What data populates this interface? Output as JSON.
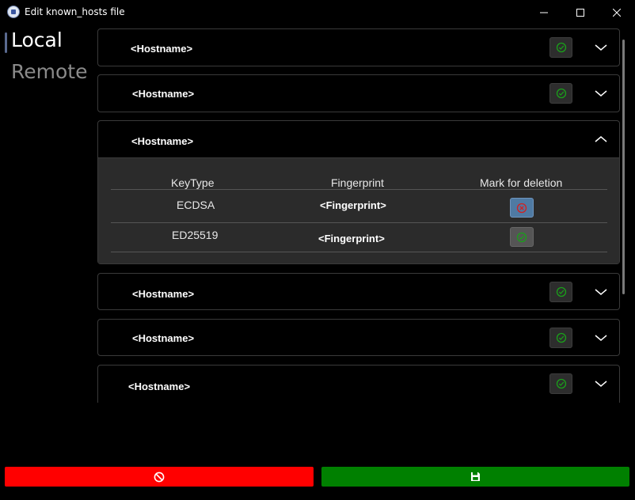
{
  "window": {
    "title": "Edit known_hosts file",
    "icons": {
      "app": "app-icon",
      "minimize": "minimize-icon",
      "maximize": "maximize-icon",
      "close": "close-icon"
    }
  },
  "nav": {
    "items": [
      {
        "label": "Local",
        "selected": true
      },
      {
        "label": "Remote",
        "selected": false
      }
    ]
  },
  "hosts": [
    {
      "hostname": "<Hostname>",
      "expanded": false,
      "status_icon": "check-circle-icon"
    },
    {
      "hostname": "<Hostname>",
      "expanded": false,
      "status_icon": "check-circle-icon"
    },
    {
      "hostname": "<Hostname>",
      "expanded": true
    },
    {
      "hostname": "<Hostname>",
      "expanded": false,
      "status_icon": "check-circle-icon"
    },
    {
      "hostname": "<Hostname>",
      "expanded": false,
      "status_icon": "check-circle-icon"
    },
    {
      "hostname": "<Hostname>",
      "expanded": false,
      "status_icon": "check-circle-icon"
    }
  ],
  "keys_table": {
    "headers": [
      "KeyType",
      "Fingerprint",
      "Mark for deletion"
    ],
    "rows": [
      {
        "keytype": "ECDSA",
        "fingerprint": "<Fingerprint>",
        "marked": true,
        "icon": "x-circle-icon"
      },
      {
        "keytype": "ED25519",
        "fingerprint": "<Fingerprint>",
        "marked": false,
        "icon": "check-circle-icon"
      }
    ]
  },
  "actions": {
    "cancel": {
      "icon": "ban-icon",
      "color": "#ff0000"
    },
    "save": {
      "icon": "save-icon",
      "color": "#008000"
    }
  },
  "colors": {
    "background": "#000000",
    "check_green": "#1aa01a",
    "delete_red": "#d32020",
    "delete_marked_bg": "#4f7aa3"
  }
}
